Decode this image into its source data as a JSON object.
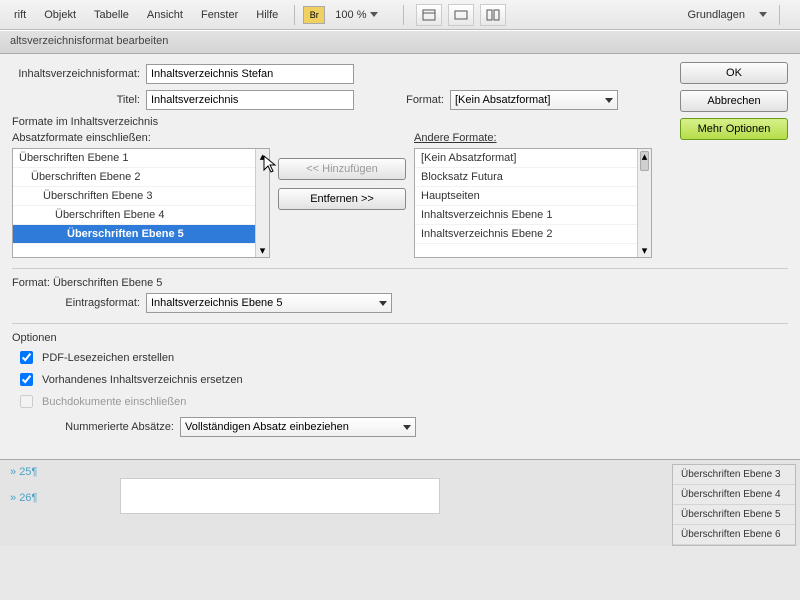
{
  "menubar": {
    "items": [
      "rift",
      "Objekt",
      "Tabelle",
      "Ansicht",
      "Fenster",
      "Hilfe"
    ],
    "badge": "Br",
    "zoom": "100 %",
    "workspace": "Grundlagen"
  },
  "dialog": {
    "title": "altsverzeichnisformat bearbeiten",
    "toc_format_label": "Inhaltsverzeichnisformat:",
    "toc_format_value": "Inhaltsverzeichnis Stefan",
    "title_label": "Titel:",
    "title_value": "Inhaltsverzeichnis",
    "format_label": "Format:",
    "format_value": "[Kein Absatzformat]",
    "section_formats": "Formate im Inhaltsverzeichnis",
    "include_label": "Absatzformate einschließen:",
    "other_label": "Andere Formate:",
    "include_items": [
      {
        "label": "Überschriften Ebene 1",
        "indent": 0
      },
      {
        "label": "Überschriften Ebene 2",
        "indent": 1
      },
      {
        "label": "Überschriften Ebene 3",
        "indent": 2
      },
      {
        "label": "Überschriften Ebene 4",
        "indent": 3
      },
      {
        "label": "Überschriften Ebene 5",
        "indent": 4,
        "selected": true
      }
    ],
    "other_items": [
      "[Kein Absatzformat]",
      "Blocksatz Futura",
      "Hauptseiten",
      "Inhaltsverzeichnis Ebene 1",
      "Inhaltsverzeichnis Ebene 2"
    ],
    "btn_add": "<< Hinzufügen",
    "btn_remove": "Entfernen >>",
    "format_section": "Format: Überschriften Ebene 5",
    "entry_format_label": "Eintragsformat:",
    "entry_format_value": "Inhaltsverzeichnis Ebene 5",
    "options_label": "Optionen",
    "opt_pdf": "PDF-Lesezeichen erstellen",
    "opt_replace": "Vorhandenes Inhaltsverzeichnis ersetzen",
    "opt_book": "Buchdokumente einschließen",
    "numbered_label": "Nummerierte Absätze:",
    "numbered_value": "Vollständigen Absatz einbeziehen",
    "btn_ok": "OK",
    "btn_cancel": "Abbrechen",
    "btn_more": "Mehr Optionen"
  },
  "doc": {
    "lines": [
      "25",
      "26"
    ],
    "panel_items": [
      "Überschriften Ebene 3",
      "Überschriften Ebene 4",
      "Überschriften Ebene 5",
      "Überschriften Ebene 6"
    ]
  }
}
